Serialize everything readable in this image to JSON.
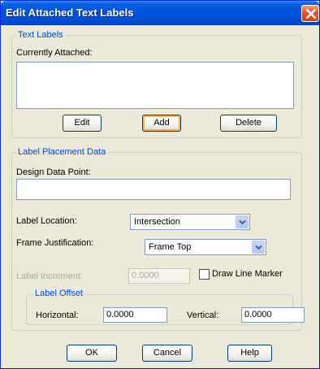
{
  "window": {
    "title": "Edit Attached Text Labels"
  },
  "text_labels": {
    "legend": "Text Labels",
    "currently_attached_label": "Currently Attached:",
    "currently_attached_items": [],
    "edit_button": "Edit",
    "add_button": "Add",
    "delete_button": "Delete"
  },
  "placement": {
    "legend": "Label Placement Data",
    "design_data_point_label": "Design Data Point:",
    "design_data_point_value": "",
    "label_location_label": "Label Location:",
    "label_location_value": "Intersection",
    "frame_justification_label": "Frame Justification:",
    "frame_justification_value": "Frame Top",
    "label_increment_label": "Label Increment:",
    "label_increment_value": "0.0000",
    "draw_line_marker_label": "Draw Line Marker",
    "draw_line_marker_checked": false,
    "offset": {
      "legend": "Label Offset",
      "horizontal_label": "Horizontal:",
      "horizontal_value": "0.0000",
      "vertical_label": "Vertical:",
      "vertical_value": "0.0000"
    }
  },
  "footer": {
    "ok_button": "OK",
    "cancel_button": "Cancel",
    "help_button": "Help"
  },
  "colors": {
    "titlebar": "#0053e1",
    "dialog_bg": "#ece9d8",
    "group_legend": "#0046d5",
    "close_button": "#e5532d"
  },
  "icons": {
    "close": "close-icon",
    "dropdown": "chevron-down-icon"
  }
}
